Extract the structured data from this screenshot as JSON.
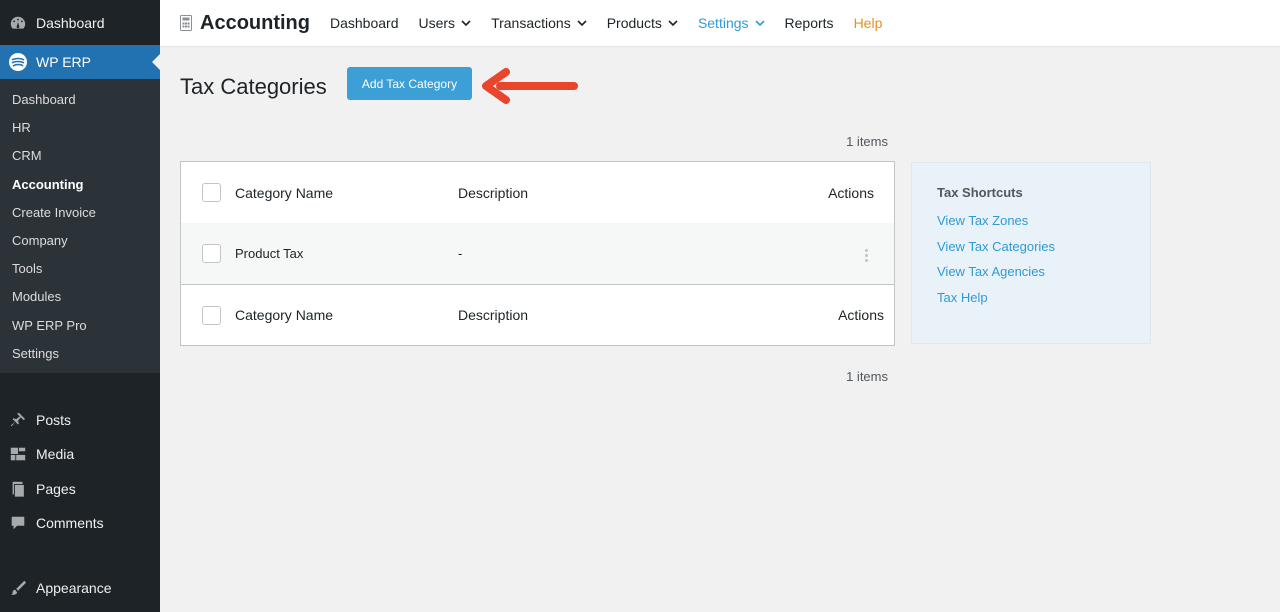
{
  "sidebar": {
    "top_item": "Dashboard",
    "active_menu": "WP ERP",
    "submenu": [
      "Dashboard",
      "HR",
      "CRM",
      "Accounting",
      "Create Invoice",
      "Company",
      "Tools",
      "Modules",
      "WP ERP Pro",
      "Settings"
    ],
    "current_submenu": "Accounting",
    "items": [
      "Posts",
      "Media",
      "Pages",
      "Comments",
      "Appearance"
    ]
  },
  "topbar": {
    "title": "Accounting",
    "nav": [
      "Dashboard",
      "Users",
      "Transactions",
      "Products",
      "Settings",
      "Reports",
      "Help"
    ]
  },
  "main": {
    "page_title": "Tax Categories",
    "add_button": "Add Tax Category",
    "items_top": "1 items",
    "items_bottom": "1 items",
    "columns": [
      "Category Name",
      "Description",
      "Actions"
    ],
    "rows": [
      {
        "name": "Product Tax",
        "description": "-"
      }
    ]
  },
  "shortcuts": {
    "title": "Tax Shortcuts",
    "links": [
      "View Tax Zones",
      "View Tax Categories",
      "View Tax Agencies",
      "Tax Help"
    ]
  },
  "colors": {
    "sidebar_bg": "#1d2327",
    "active_menu": "#2271b1",
    "button": "#3c9fd6",
    "link": "#2e9bd6",
    "help": "#e6901f",
    "arrow": "#e8452c"
  }
}
